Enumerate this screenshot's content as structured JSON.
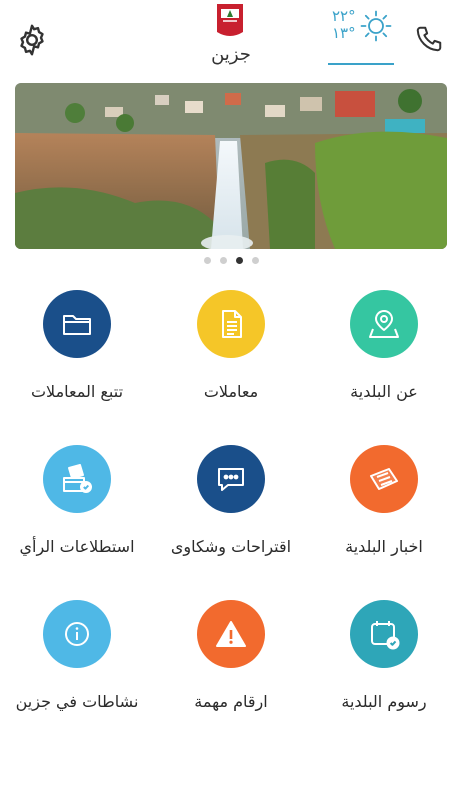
{
  "header": {
    "town_name": "جزين",
    "temp_high": "٢٢°",
    "temp_low": "١٣°",
    "settings_icon": "gear-icon",
    "phone_icon": "phone-icon",
    "weather_icon": "sun-icon"
  },
  "carousel": {
    "slides": 4,
    "active_index": 2
  },
  "colors": {
    "accent": "#3aa2c9",
    "teal": "#35c6a1",
    "yellow": "#f5c628",
    "navy": "#1a4f8a",
    "orange": "#f26a2e",
    "light_blue": "#4fb8e6",
    "cyan": "#2ea6b8"
  },
  "menu": {
    "about": "عن البلدية",
    "transactions": "معاملات",
    "track": "تتبع المعاملات",
    "news": "اخبار البلدية",
    "complaints": "اقتراحات وشكاوى",
    "polls": "استطلاعات  الرأي",
    "fees": "رسوم البلدية",
    "numbers": "ارقام مهمة",
    "activities": "نشاطات في جزين"
  }
}
